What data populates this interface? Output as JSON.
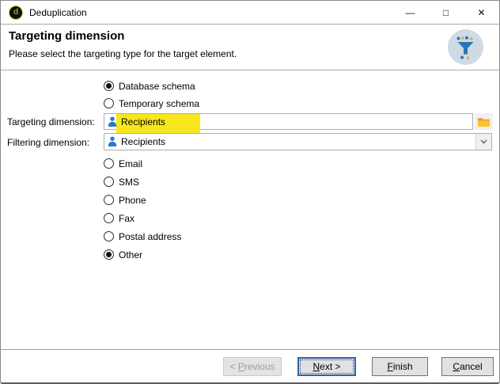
{
  "window": {
    "title": "Deduplication",
    "icons": {
      "minimize": "—",
      "maximize": "□",
      "close": "✕",
      "app_glyph": "d"
    }
  },
  "header": {
    "title": "Targeting dimension",
    "subtitle": "Please select the targeting type for the target element."
  },
  "schema_options": [
    {
      "label": "Database schema",
      "selected": true
    },
    {
      "label": "Temporary schema",
      "selected": false
    }
  ],
  "fields": {
    "targeting": {
      "label": "Targeting dimension:",
      "value": "Recipients",
      "highlighted": true
    },
    "filtering": {
      "label": "Filtering dimension:",
      "value": "Recipients"
    }
  },
  "channel_options": [
    {
      "label": "Email",
      "selected": false
    },
    {
      "label": "SMS",
      "selected": false
    },
    {
      "label": "Phone",
      "selected": false
    },
    {
      "label": "Fax",
      "selected": false
    },
    {
      "label": "Postal address",
      "selected": false
    },
    {
      "label": "Other",
      "selected": true
    }
  ],
  "footer": {
    "previous": {
      "pre": "< ",
      "key": "P",
      "post": "revious",
      "enabled": false
    },
    "next": {
      "pre": "",
      "key": "N",
      "post": "ext >",
      "focused": true
    },
    "finish": {
      "pre": "",
      "key": "F",
      "post": "inish",
      "enabled": true
    },
    "cancel": {
      "pre": "",
      "key": "C",
      "post": "ancel",
      "enabled": true
    }
  },
  "colors": {
    "highlight_yellow": "#f8e71c",
    "dimension_icon_blue": "#2b79c6",
    "folder_yellow": "#fcc12e",
    "folder_flap_orange": "#e09a2f",
    "badge_background": "#cddbe7",
    "funnel_blue": "#2e74b5",
    "mark_orange": "#e8a33d",
    "focus_border_blue": "#2664ad"
  }
}
